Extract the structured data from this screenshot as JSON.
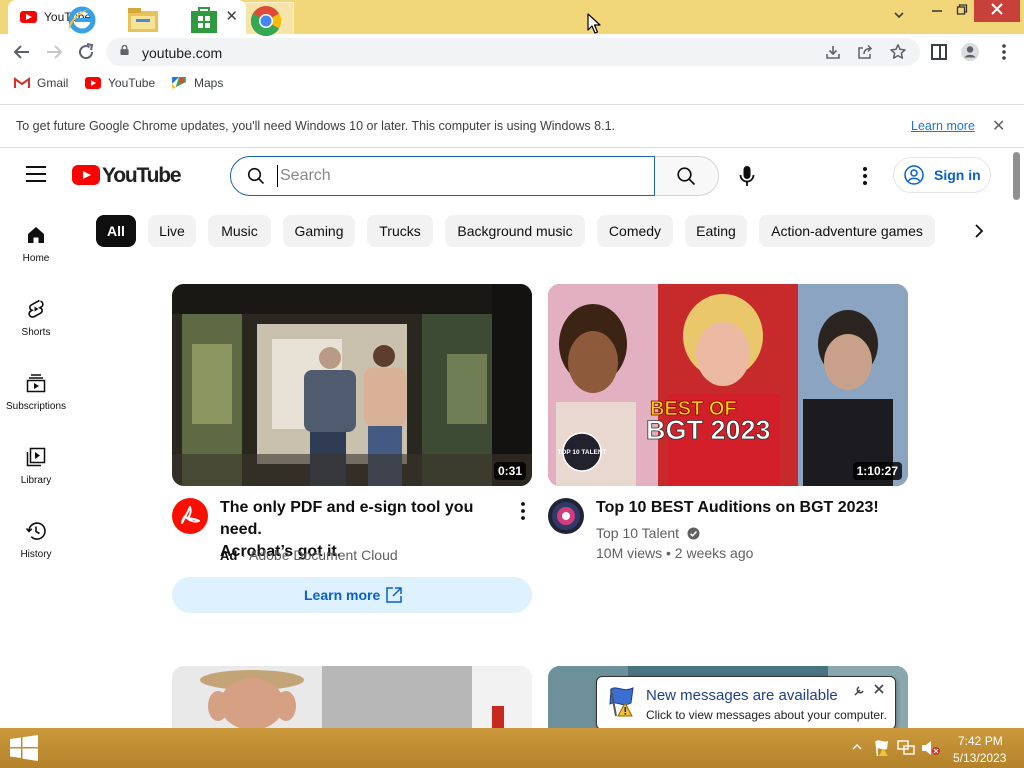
{
  "browser": {
    "tab_title": "YouTube",
    "tab_close": "✕",
    "new_tab": "+",
    "url": "youtube.com",
    "bookmarks": [
      {
        "label": "Gmail"
      },
      {
        "label": "YouTube"
      },
      {
        "label": "Maps"
      }
    ],
    "infobar": {
      "message": "To get future Google Chrome updates, you'll need Windows 10 or later. This computer is using Windows 8.1.",
      "link": "Learn more",
      "close": "✕"
    }
  },
  "youtube": {
    "logo_text": "YouTube",
    "search_placeholder": "Search",
    "sign_in": "Sign in",
    "chips": [
      "All",
      "Live",
      "Music",
      "Gaming",
      "Trucks",
      "Background music",
      "Comedy",
      "Eating",
      "Action-adventure games"
    ],
    "nav": [
      {
        "label": "Home"
      },
      {
        "label": "Shorts"
      },
      {
        "label": "Subscriptions"
      },
      {
        "label": "Library"
      },
      {
        "label": "History"
      }
    ],
    "videos": [
      {
        "title_line1": "The only PDF and e-sign tool you need.",
        "title_line2": "Acrobat’s got it.",
        "ad_label": "Ad",
        "channel": "· Adobe Document Cloud",
        "duration": "0:31",
        "cta": "Learn more"
      },
      {
        "title": "Top 10 BEST Auditions on BGT 2023!",
        "channel": "Top 10 Talent",
        "meta": "10M views • 2 weeks ago",
        "duration": "1:10:27",
        "thumb_text1": "BEST OF",
        "thumb_text2": "BGT 2023",
        "badge_text": "TOP 10 TALENT"
      }
    ]
  },
  "notification": {
    "title": "New messages are available",
    "body": "Click to view messages about your computer."
  },
  "taskbar": {
    "time": "7:42 PM",
    "date": "5/13/2023"
  }
}
